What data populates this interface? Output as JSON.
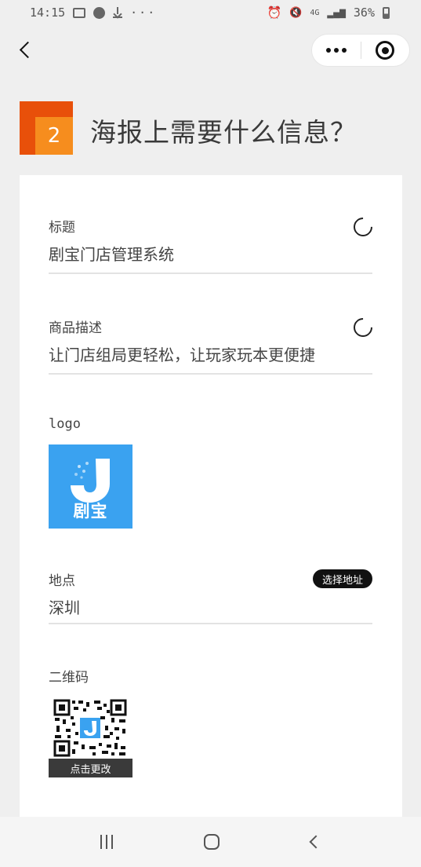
{
  "status_bar": {
    "time": "14:15",
    "more_dots": "···",
    "network": "4G",
    "battery": "36%"
  },
  "header": {
    "back_icon": "chevron-left-icon",
    "more_icon": "more-dots-icon",
    "close_icon": "target-close-icon"
  },
  "section": {
    "step_number": "2",
    "title": "海报上需要什么信息？"
  },
  "form": {
    "title_field": {
      "label": "标题",
      "value": "剧宝门店管理系统"
    },
    "description_field": {
      "label": "商品描述",
      "value": "让门店组局更轻松，让玩家玩本更便捷"
    },
    "logo_field": {
      "label": "logo",
      "logo_text": "剧宝"
    },
    "location_field": {
      "label": "地点",
      "value": "深圳",
      "action_label": "选择地址"
    },
    "qrcode_field": {
      "label": "二维码",
      "caption": "点击更改"
    }
  },
  "colors": {
    "accent_orange": "#f68d1e",
    "accent_orange_dark": "#e8500a",
    "logo_blue": "#3aa2f0"
  }
}
